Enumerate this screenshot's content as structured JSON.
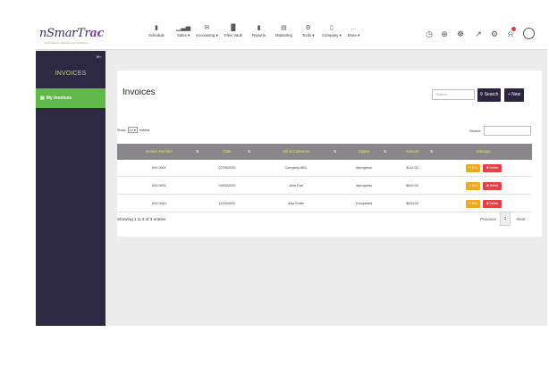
{
  "brand": {
    "logo_main": "nSmarTr",
    "logo_accent": "ac",
    "tagline": "Field Service Management Software"
  },
  "nav": {
    "items": [
      {
        "label": "Schedule",
        "icon": "bookmark-icon",
        "glyph": "▮"
      },
      {
        "label": "Sales ▾",
        "icon": "bar-chart-icon",
        "glyph": "▁▃▅"
      },
      {
        "label": "Accounting ▾",
        "icon": "envelope-icon",
        "glyph": "✉"
      },
      {
        "label": "Files Vault",
        "icon": "chart-icon",
        "glyph": "▐▌"
      },
      {
        "label": "Reports",
        "icon": "bookmark-icon",
        "glyph": "▮"
      },
      {
        "label": "Marketing",
        "icon": "document-icon",
        "glyph": "▤"
      },
      {
        "label": "Tools ▾",
        "icon": "gear-icon",
        "glyph": "⚙"
      },
      {
        "label": "Company ▾",
        "icon": "phone-icon",
        "glyph": "▯"
      },
      {
        "label": "More ▾",
        "icon": "more-icon",
        "glyph": "…"
      }
    ],
    "right_icons": [
      {
        "name": "clock-icon",
        "glyph": "◷"
      },
      {
        "name": "add-circle-icon",
        "glyph": "⊕"
      },
      {
        "name": "chat-icon",
        "glyph": "☸"
      },
      {
        "name": "trend-chart-icon",
        "glyph": "↗"
      },
      {
        "name": "settings-icon",
        "glyph": "⚙"
      },
      {
        "name": "bell-icon",
        "glyph": "⍾"
      }
    ]
  },
  "sidebar": {
    "title": "INVOICES",
    "collapse_glyph": "⇤",
    "items": [
      {
        "label": "My Invoices",
        "icon": "document-icon",
        "glyph": "▤"
      }
    ]
  },
  "main": {
    "title": "Invoices",
    "search_placeholder": "Search...",
    "search_button": "⚲ Search",
    "new_button": "+ New",
    "show_prefix": "Show",
    "show_value": "10 ▾",
    "show_suffix": "entries",
    "table_search_label": "Search:",
    "columns": [
      "Invoice Number",
      "Date",
      "Job & Customer",
      "Status",
      "Amount",
      "Manage"
    ],
    "sort_glyph": "⇅",
    "rows": [
      {
        "invoice": "INV-0001",
        "date": "07/05/2020",
        "customer": "Company ABC",
        "status": "Inprogress",
        "amount": "$112.00"
      },
      {
        "invoice": "INV-0002",
        "date": "04/03/2020",
        "customer": "John Doe",
        "status": "Inprogress",
        "amount": "$500.00"
      },
      {
        "invoice": "INV-0010",
        "date": "11/04/2020",
        "customer": "Ana Smith",
        "status": "Completed",
        "amount": "$620.00"
      }
    ],
    "edit_label": "✎ Edit",
    "delete_label": "✖ Delete",
    "info": "Showing 1 to 3 of 3 entries",
    "pagination": {
      "prev": "Previous",
      "current": "1",
      "next": "Next"
    }
  },
  "colors": {
    "sidebar": "#2e2942",
    "active": "#5fb848",
    "header": "#8a878c",
    "header_text": "#e4e66a",
    "edit": "#f0a91e",
    "delete": "#e2434a"
  }
}
